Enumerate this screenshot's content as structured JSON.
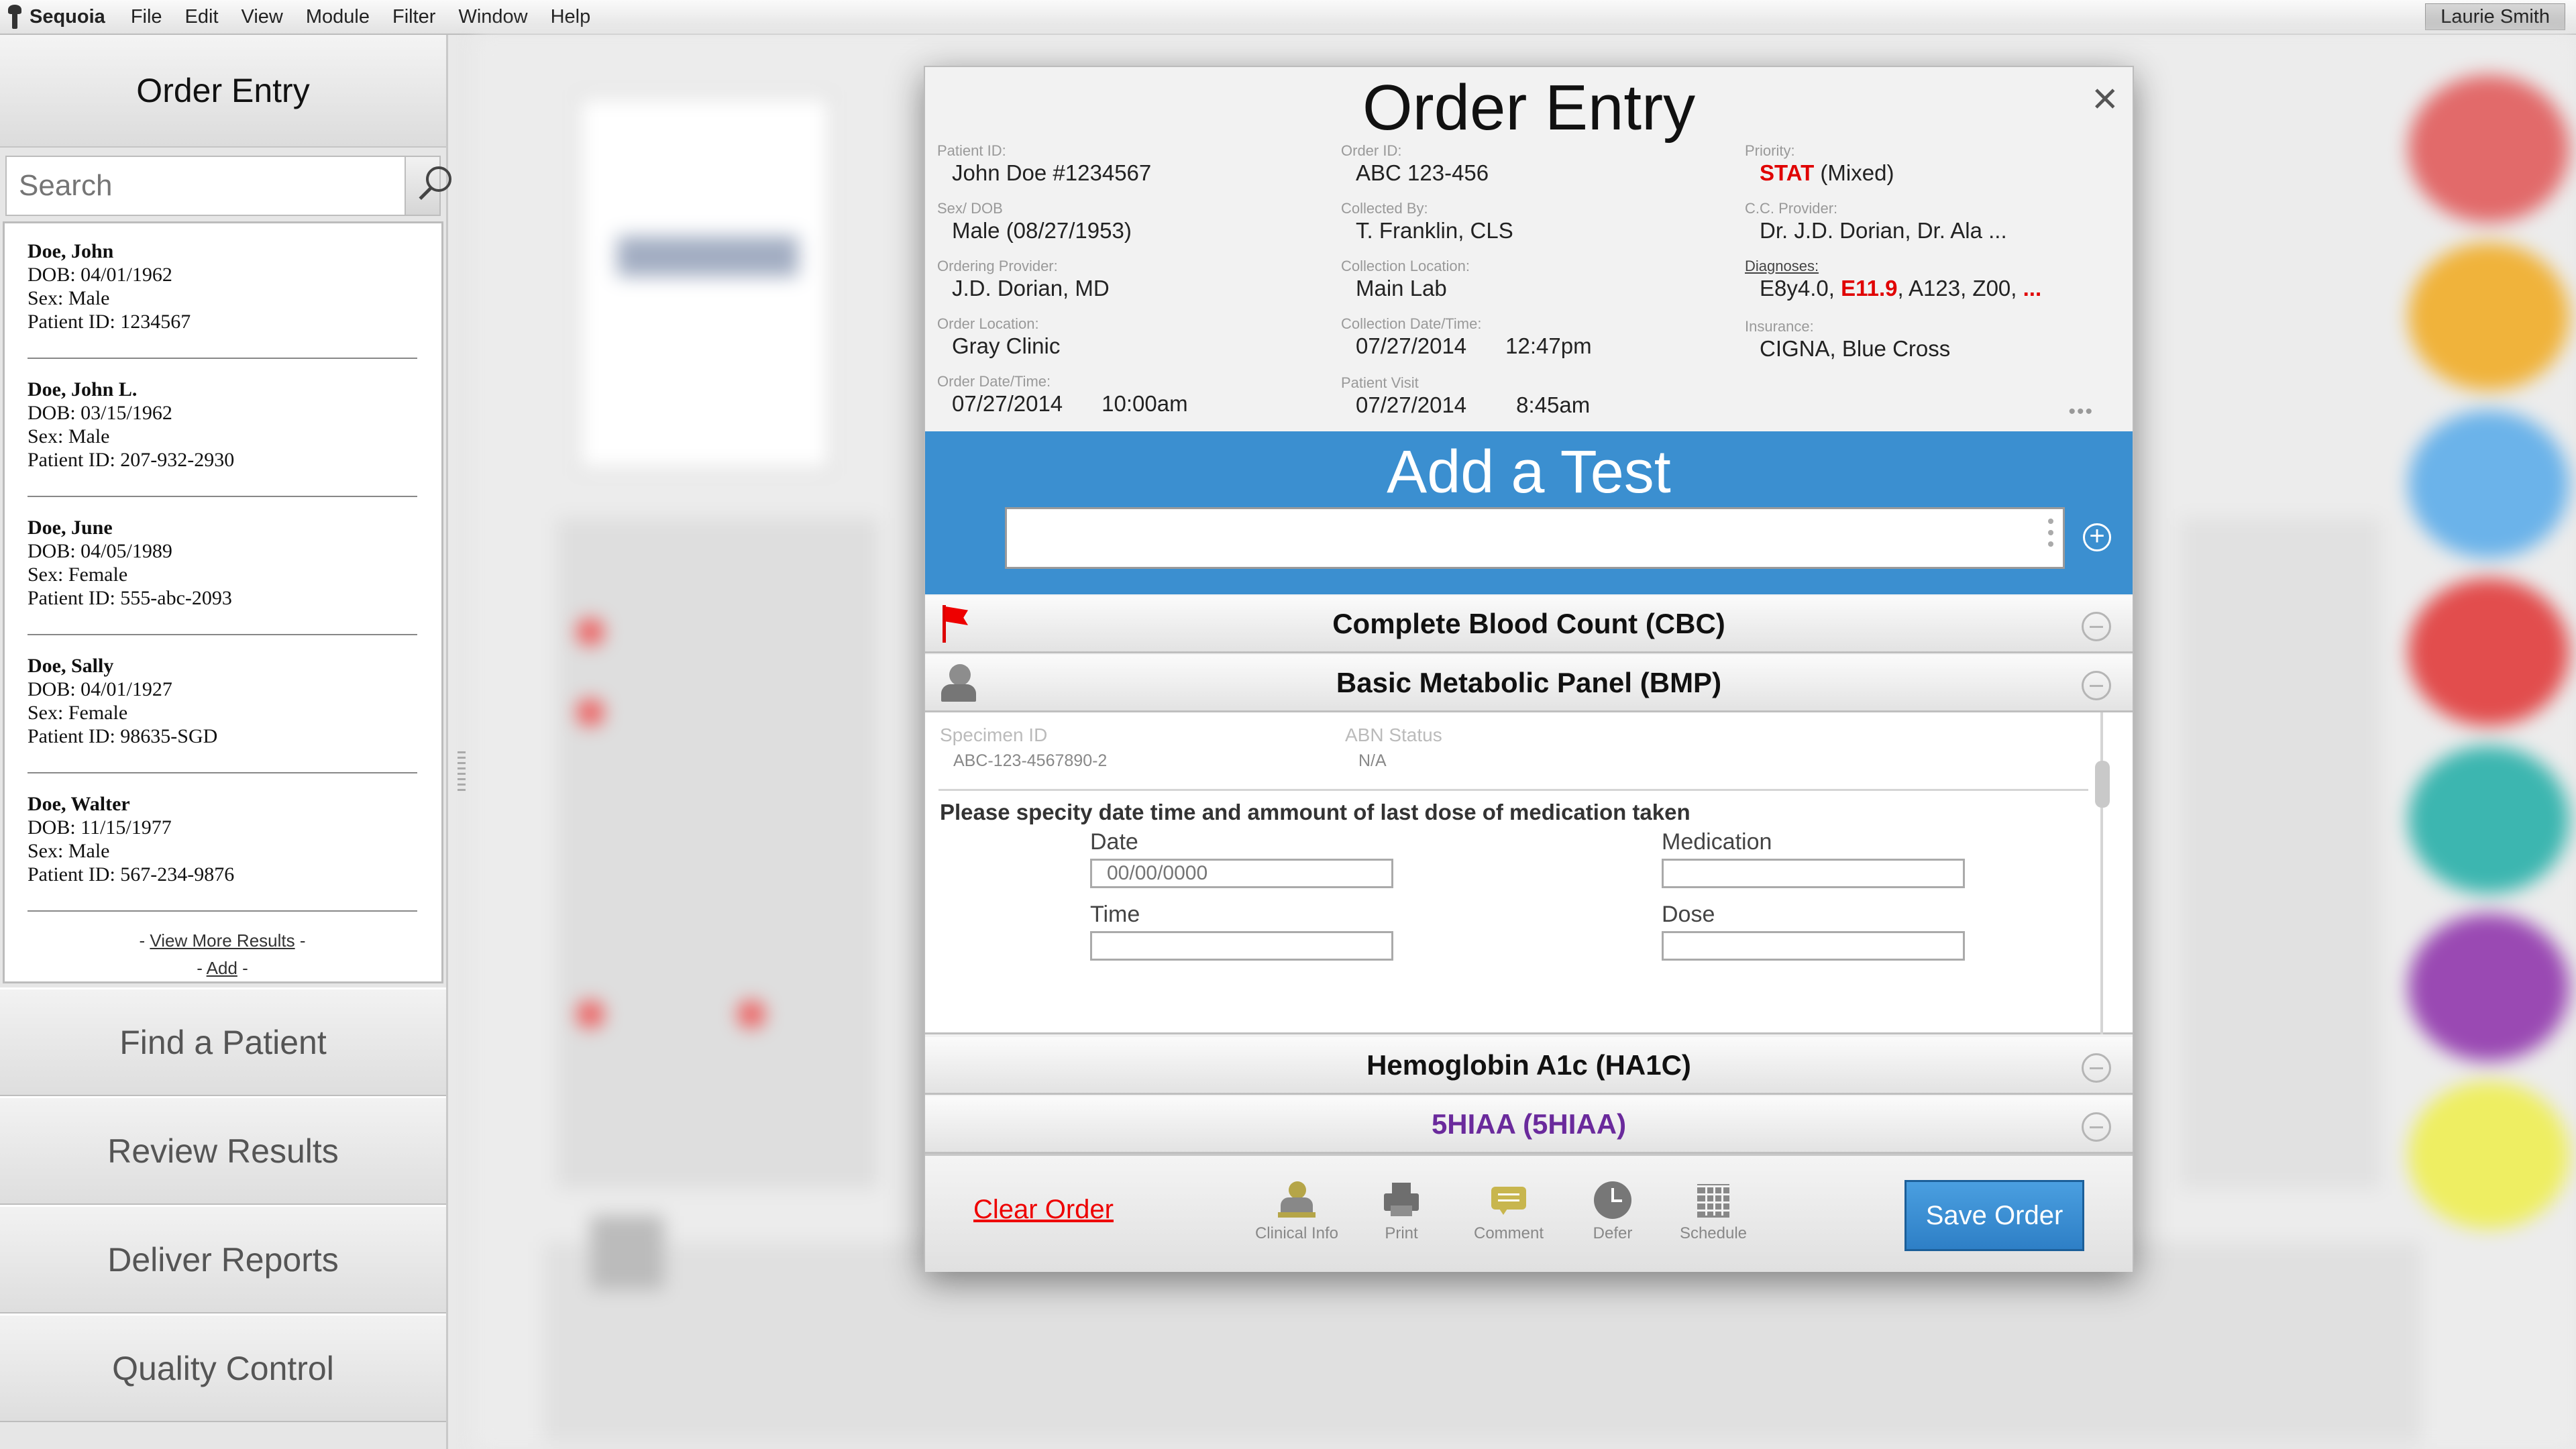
{
  "menubar": {
    "app_name": "Sequoia",
    "menus": [
      "File",
      "Edit",
      "View",
      "Module",
      "Filter",
      "Window",
      "Help"
    ],
    "user": "Laurie  Smith"
  },
  "sidebar": {
    "title": "Order Entry",
    "search_placeholder": "Search",
    "patients": [
      {
        "name": "Doe, John",
        "dob": "DOB: 04/01/1962",
        "sex": "Sex: Male",
        "pid": "Patient ID: 1234567"
      },
      {
        "name": "Doe, John L.",
        "dob": "DOB: 03/15/1962",
        "sex": "Sex: Male",
        "pid": "Patient ID: 207-932-2930"
      },
      {
        "name": "Doe, June",
        "dob": "DOB: 04/05/1989",
        "sex": "Sex: Female",
        "pid": "Patient ID: 555-abc-2093"
      },
      {
        "name": "Doe, Sally",
        "dob": "DOB: 04/01/1927",
        "sex": "Sex: Female",
        "pid": "Patient ID: 98635-SGD"
      },
      {
        "name": "Doe, Walter",
        "dob": "DOB: 11/15/1977",
        "sex": "Sex: Male",
        "pid": "Patient ID: 567-234-9876"
      }
    ],
    "view_more": "View More Results",
    "add": "Add",
    "nav": [
      "Find a Patient",
      "Review Results",
      "Deliver Reports",
      "Quality Control"
    ]
  },
  "modal": {
    "title": "Order Entry",
    "close": "×",
    "fields": {
      "patient_id": {
        "label": "Patient ID:",
        "value": "John Doe   #1234567"
      },
      "sex_dob": {
        "label": "Sex/ DOB",
        "value": "Male    (08/27/1953)"
      },
      "ordering_provider": {
        "label": "Ordering Provider:",
        "value": "J.D. Dorian, MD"
      },
      "order_location": {
        "label": "Order Location:",
        "value": "Gray Clinic"
      },
      "order_datetime": {
        "label": "Order Date/Time:",
        "date": "07/27/2014",
        "time": "10:00am"
      },
      "order_id": {
        "label": "Order ID:",
        "value": "ABC 123-456"
      },
      "collected_by": {
        "label": "Collected By:",
        "value": "T. Franklin, CLS"
      },
      "collection_location": {
        "label": "Collection Location:",
        "value": "Main Lab"
      },
      "collection_datetime": {
        "label": "Collection Date/Time:",
        "date": "07/27/2014",
        "time": "12:47pm"
      },
      "patient_visit": {
        "label": "Patient Visit",
        "date": "07/27/2014",
        "time": "8:45am"
      },
      "priority": {
        "label": "Priority:",
        "stat": "STAT",
        "rest": " (Mixed)"
      },
      "cc_provider": {
        "label": "C.C. Provider:",
        "value": "Dr. J.D. Dorian, Dr. Ala ..."
      },
      "diagnoses": {
        "label": "Diagnoses:",
        "d1": "E8y4.0, ",
        "d2": "E11.9",
        "d3": ", A123, Z00, ",
        "d4": "..."
      },
      "insurance": {
        "label": "Insurance:",
        "value": "CIGNA, Blue Cross"
      }
    },
    "more": "•••",
    "add_test": {
      "title": "Add a Test",
      "plus": "+"
    },
    "tests": [
      "Complete Blood Count (CBC)",
      "Basic Metabolic Panel (BMP)",
      "Hemoglobin A1c (HA1C)",
      "5HIAA (5HIAA)"
    ],
    "detail": {
      "specimen_label": "Specimen ID",
      "specimen_value": "ABC-123-4567890-2",
      "abn_label": "ABN Status",
      "abn_value": "N/A",
      "prompt": "Please specity date time and ammount of last dose of medication taken",
      "date_label": "Date",
      "date_placeholder": "00/00/0000",
      "time_label": "Time",
      "medication_label": "Medication",
      "dose_label": "Dose"
    },
    "footer": {
      "clear": "Clear Order",
      "clinical_info": "Clinical Info",
      "print": "Print",
      "comment": "Comment",
      "defer": "Defer",
      "schedule": "Schedule",
      "save": "Save Order"
    }
  },
  "colors": {
    "accent_blue": "#3b8fd0",
    "alert_red": "#e00000",
    "purple_test": "#6a2a9c"
  }
}
